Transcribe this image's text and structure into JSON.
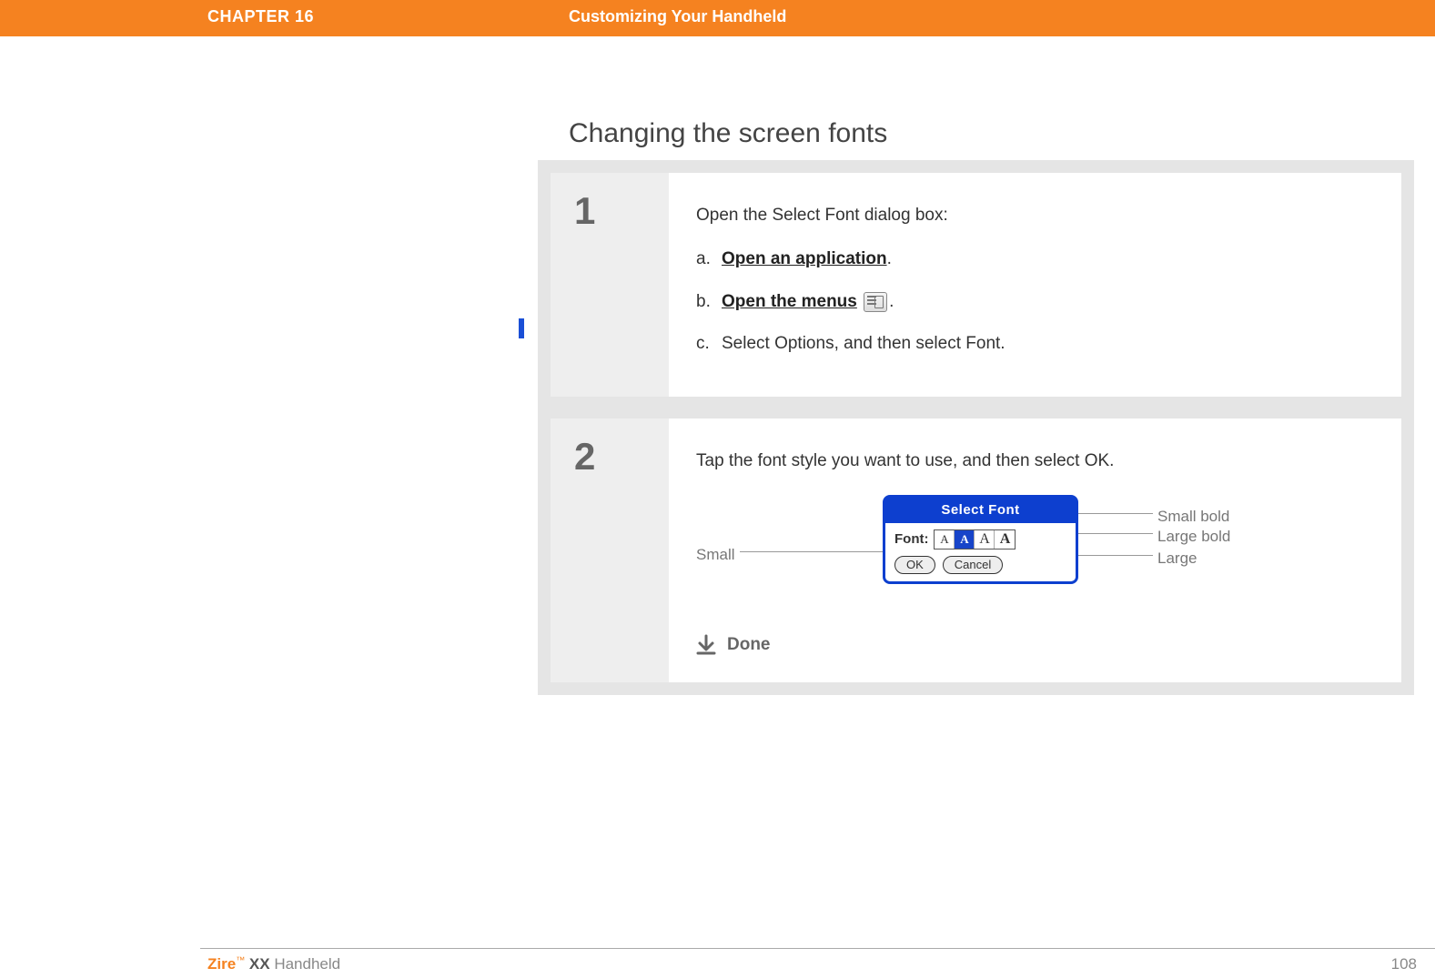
{
  "header": {
    "chapter": "CHAPTER 16",
    "title": "Customizing Your Handheld"
  },
  "section": {
    "heading": "Changing the screen fonts"
  },
  "steps": [
    {
      "number": "1",
      "intro": "Open the Select Font dialog box:",
      "sub": [
        {
          "letter": "a.",
          "link_text": "Open an application",
          "tail": "."
        },
        {
          "letter": "b.",
          "link_text": "Open the menus",
          "tail": ".",
          "has_icon": true
        },
        {
          "letter": "c.",
          "plain_text": "Select Options, and then select Font."
        }
      ]
    },
    {
      "number": "2",
      "intro": "Tap the font style you want to use, and then select OK.",
      "callouts": {
        "left": "Small",
        "right_top": "Small bold",
        "right_mid": "Large bold",
        "right_bot": "Large"
      },
      "dialog": {
        "title": "Select Font",
        "font_label": "Font:",
        "options": [
          "A",
          "A",
          "A",
          "A"
        ],
        "selected_index": 1,
        "ok": "OK",
        "cancel": "Cancel"
      },
      "done": "Done"
    }
  ],
  "footer": {
    "brand": "Zire",
    "tm": "™",
    "model": " XX",
    "suffix": " Handheld",
    "page": "108"
  }
}
